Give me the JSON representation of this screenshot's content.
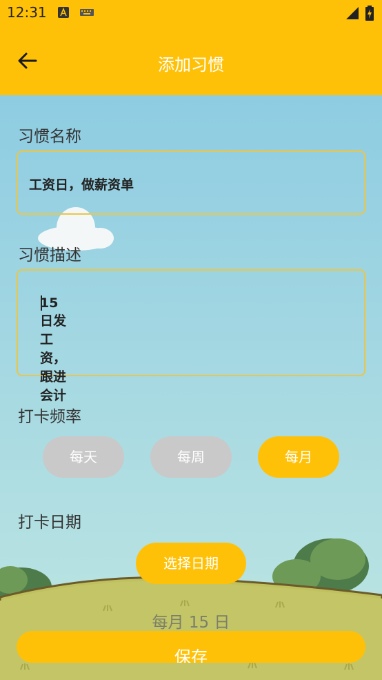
{
  "status_bar": {
    "time": "12:31"
  },
  "app_bar": {
    "title": "添加习惯"
  },
  "form": {
    "name_label": "习惯名称",
    "name_value": "工资日，做薪资单",
    "desc_label": "习惯描述",
    "desc_value": "15日发工资，跟进会计",
    "frequency_label": "打卡频率",
    "frequency_options": [
      "每天",
      "每周",
      "每月"
    ],
    "frequency_selected": "每月",
    "date_label": "打卡日期",
    "pick_date_button": "选择日期",
    "selected_date_text": "每月 15 日",
    "save_button": "保存"
  },
  "colors": {
    "accent": "#FFC107",
    "chip_off": "#C9C9C9"
  }
}
